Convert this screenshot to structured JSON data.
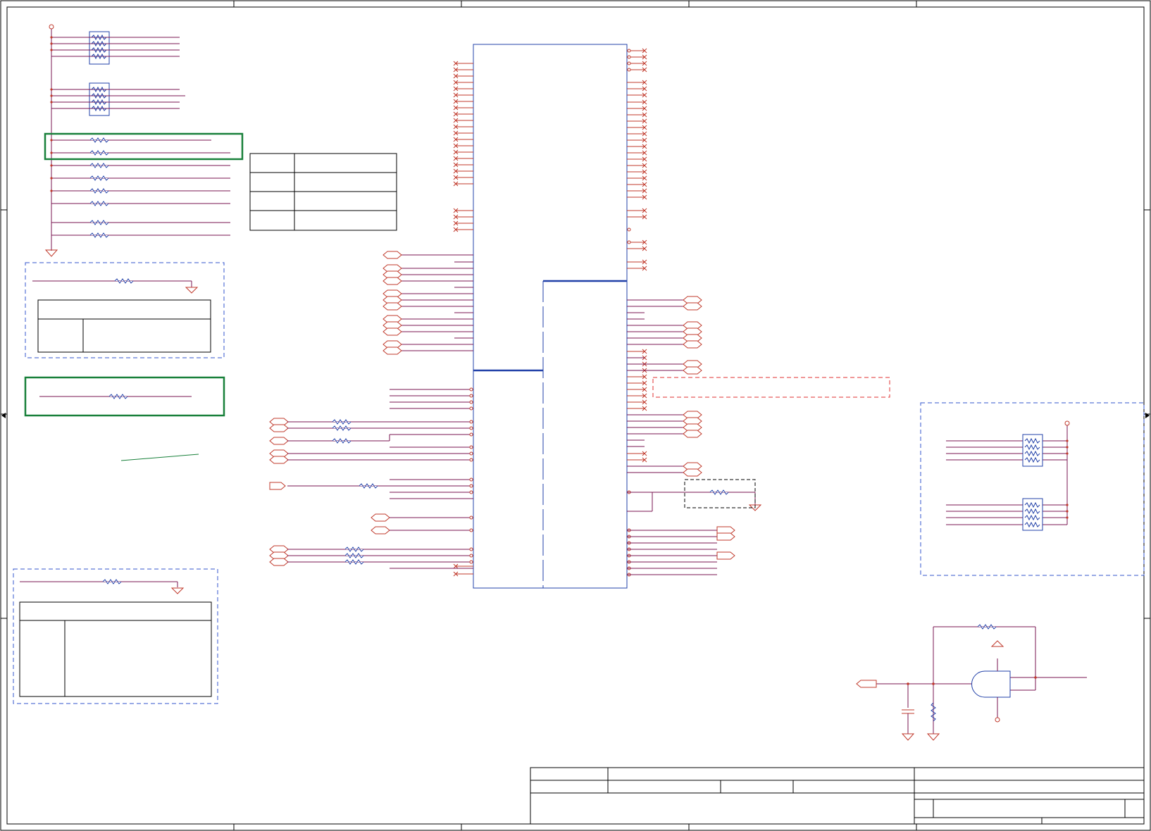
{
  "sheet": {
    "background": "#ffffff",
    "colors": {
      "net": "#c0392b",
      "wire": "#7a1550",
      "part": "#2140a8",
      "highlight_box": "#18803a",
      "table": "#000000",
      "note_box": "#3355cc"
    },
    "zone_numbers_top": [],
    "zone_letters_side": [],
    "title_block": {
      "title": "",
      "doc_number": "",
      "rev": "",
      "sheet": "",
      "date": ""
    },
    "config_table_top": {
      "rows": [
        [
          "",
          ""
        ],
        [
          "",
          ""
        ],
        [
          "",
          ""
        ],
        [
          "",
          ""
        ]
      ]
    },
    "note_table_left_1": {
      "header": "",
      "body": [
        "",
        ""
      ]
    },
    "note_table_left_2": {
      "header": "",
      "body": [
        "",
        ""
      ]
    },
    "icons": {
      "resistor": "resistor-icon",
      "resistor_array": "resistor-array-icon",
      "ground": "ground-icon",
      "power": "power-symbol-icon",
      "offpage_connector": "offpage-connector-icon",
      "no_connect": "no-connect-icon",
      "and_gate": "and-gate-icon",
      "capacitor": "capacitor-icon"
    }
  }
}
